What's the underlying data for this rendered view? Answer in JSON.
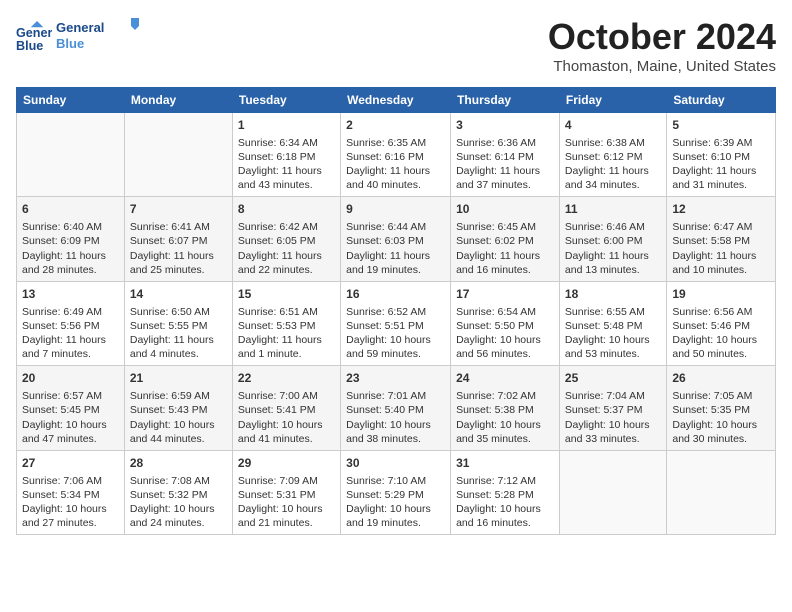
{
  "header": {
    "logo_line1": "General",
    "logo_line2": "Blue",
    "month": "October 2024",
    "location": "Thomaston, Maine, United States"
  },
  "days_of_week": [
    "Sunday",
    "Monday",
    "Tuesday",
    "Wednesday",
    "Thursday",
    "Friday",
    "Saturday"
  ],
  "weeks": [
    [
      {
        "day": "",
        "content": ""
      },
      {
        "day": "",
        "content": ""
      },
      {
        "day": "1",
        "content": "Sunrise: 6:34 AM\nSunset: 6:18 PM\nDaylight: 11 hours and 43 minutes."
      },
      {
        "day": "2",
        "content": "Sunrise: 6:35 AM\nSunset: 6:16 PM\nDaylight: 11 hours and 40 minutes."
      },
      {
        "day": "3",
        "content": "Sunrise: 6:36 AM\nSunset: 6:14 PM\nDaylight: 11 hours and 37 minutes."
      },
      {
        "day": "4",
        "content": "Sunrise: 6:38 AM\nSunset: 6:12 PM\nDaylight: 11 hours and 34 minutes."
      },
      {
        "day": "5",
        "content": "Sunrise: 6:39 AM\nSunset: 6:10 PM\nDaylight: 11 hours and 31 minutes."
      }
    ],
    [
      {
        "day": "6",
        "content": "Sunrise: 6:40 AM\nSunset: 6:09 PM\nDaylight: 11 hours and 28 minutes."
      },
      {
        "day": "7",
        "content": "Sunrise: 6:41 AM\nSunset: 6:07 PM\nDaylight: 11 hours and 25 minutes."
      },
      {
        "day": "8",
        "content": "Sunrise: 6:42 AM\nSunset: 6:05 PM\nDaylight: 11 hours and 22 minutes."
      },
      {
        "day": "9",
        "content": "Sunrise: 6:44 AM\nSunset: 6:03 PM\nDaylight: 11 hours and 19 minutes."
      },
      {
        "day": "10",
        "content": "Sunrise: 6:45 AM\nSunset: 6:02 PM\nDaylight: 11 hours and 16 minutes."
      },
      {
        "day": "11",
        "content": "Sunrise: 6:46 AM\nSunset: 6:00 PM\nDaylight: 11 hours and 13 minutes."
      },
      {
        "day": "12",
        "content": "Sunrise: 6:47 AM\nSunset: 5:58 PM\nDaylight: 11 hours and 10 minutes."
      }
    ],
    [
      {
        "day": "13",
        "content": "Sunrise: 6:49 AM\nSunset: 5:56 PM\nDaylight: 11 hours and 7 minutes."
      },
      {
        "day": "14",
        "content": "Sunrise: 6:50 AM\nSunset: 5:55 PM\nDaylight: 11 hours and 4 minutes."
      },
      {
        "day": "15",
        "content": "Sunrise: 6:51 AM\nSunset: 5:53 PM\nDaylight: 11 hours and 1 minute."
      },
      {
        "day": "16",
        "content": "Sunrise: 6:52 AM\nSunset: 5:51 PM\nDaylight: 10 hours and 59 minutes."
      },
      {
        "day": "17",
        "content": "Sunrise: 6:54 AM\nSunset: 5:50 PM\nDaylight: 10 hours and 56 minutes."
      },
      {
        "day": "18",
        "content": "Sunrise: 6:55 AM\nSunset: 5:48 PM\nDaylight: 10 hours and 53 minutes."
      },
      {
        "day": "19",
        "content": "Sunrise: 6:56 AM\nSunset: 5:46 PM\nDaylight: 10 hours and 50 minutes."
      }
    ],
    [
      {
        "day": "20",
        "content": "Sunrise: 6:57 AM\nSunset: 5:45 PM\nDaylight: 10 hours and 47 minutes."
      },
      {
        "day": "21",
        "content": "Sunrise: 6:59 AM\nSunset: 5:43 PM\nDaylight: 10 hours and 44 minutes."
      },
      {
        "day": "22",
        "content": "Sunrise: 7:00 AM\nSunset: 5:41 PM\nDaylight: 10 hours and 41 minutes."
      },
      {
        "day": "23",
        "content": "Sunrise: 7:01 AM\nSunset: 5:40 PM\nDaylight: 10 hours and 38 minutes."
      },
      {
        "day": "24",
        "content": "Sunrise: 7:02 AM\nSunset: 5:38 PM\nDaylight: 10 hours and 35 minutes."
      },
      {
        "day": "25",
        "content": "Sunrise: 7:04 AM\nSunset: 5:37 PM\nDaylight: 10 hours and 33 minutes."
      },
      {
        "day": "26",
        "content": "Sunrise: 7:05 AM\nSunset: 5:35 PM\nDaylight: 10 hours and 30 minutes."
      }
    ],
    [
      {
        "day": "27",
        "content": "Sunrise: 7:06 AM\nSunset: 5:34 PM\nDaylight: 10 hours and 27 minutes."
      },
      {
        "day": "28",
        "content": "Sunrise: 7:08 AM\nSunset: 5:32 PM\nDaylight: 10 hours and 24 minutes."
      },
      {
        "day": "29",
        "content": "Sunrise: 7:09 AM\nSunset: 5:31 PM\nDaylight: 10 hours and 21 minutes."
      },
      {
        "day": "30",
        "content": "Sunrise: 7:10 AM\nSunset: 5:29 PM\nDaylight: 10 hours and 19 minutes."
      },
      {
        "day": "31",
        "content": "Sunrise: 7:12 AM\nSunset: 5:28 PM\nDaylight: 10 hours and 16 minutes."
      },
      {
        "day": "",
        "content": ""
      },
      {
        "day": "",
        "content": ""
      }
    ]
  ]
}
